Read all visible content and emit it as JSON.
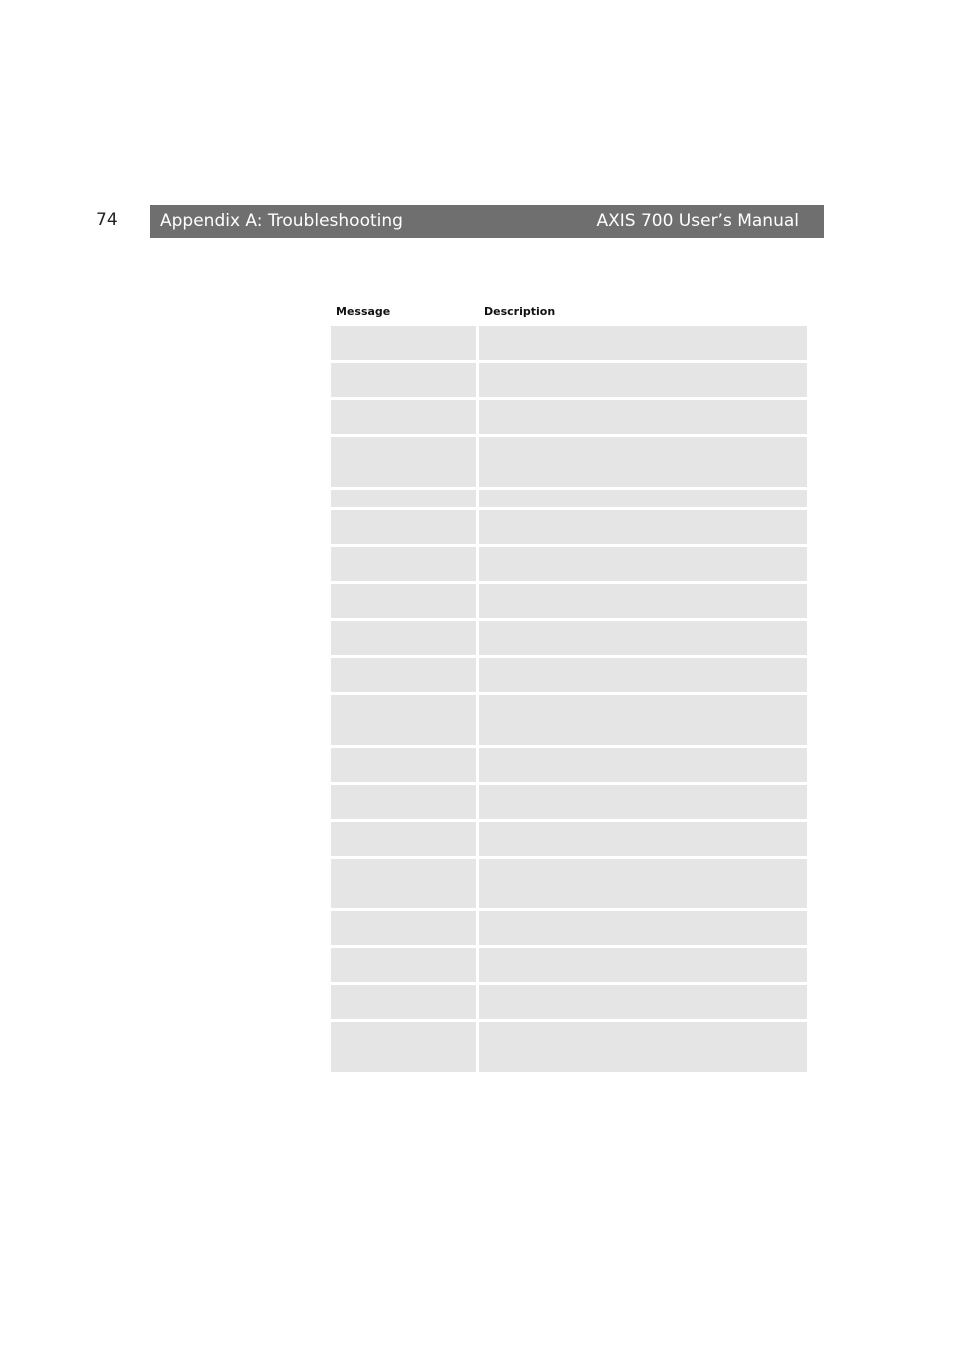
{
  "page": {
    "number": "74",
    "header_left": "Appendix A: Troubleshooting",
    "header_right": "AXIS 700 User’s Manual"
  },
  "table": {
    "headers": {
      "message": "Message",
      "description": "Description"
    },
    "rows": [
      {
        "message": "",
        "description": ""
      },
      {
        "message": "",
        "description": ""
      },
      {
        "message": "",
        "description": ""
      },
      {
        "message": "",
        "description": ""
      },
      {
        "message": "",
        "description": ""
      },
      {
        "message": "",
        "description": ""
      },
      {
        "message": "",
        "description": ""
      },
      {
        "message": "",
        "description": ""
      },
      {
        "message": "",
        "description": ""
      },
      {
        "message": "",
        "description": ""
      },
      {
        "message": "",
        "description": ""
      },
      {
        "message": "",
        "description": ""
      },
      {
        "message": "",
        "description": ""
      },
      {
        "message": "",
        "description": ""
      },
      {
        "message": "",
        "description": ""
      },
      {
        "message": "",
        "description": ""
      },
      {
        "message": "",
        "description": ""
      },
      {
        "message": "",
        "description": ""
      },
      {
        "message": "",
        "description": ""
      }
    ]
  }
}
